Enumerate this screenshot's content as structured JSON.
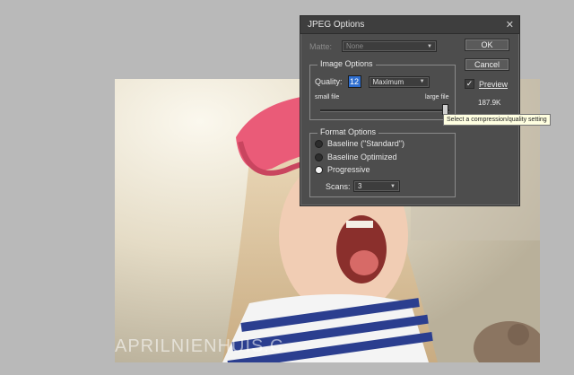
{
  "dialog": {
    "title": "JPEG Options",
    "close_icon": "close-icon",
    "matte_label": "Matte:",
    "matte_value": "None",
    "ok_label": "OK",
    "cancel_label": "Cancel",
    "preview_label": "Preview",
    "preview_checked": true,
    "file_size": "187.9K",
    "image_options": {
      "title": "Image Options",
      "quality_label": "Quality:",
      "quality_value": "12",
      "quality_preset": "Maximum",
      "small_file_label": "small file",
      "large_file_label": "large file",
      "slider_level": 1.0
    },
    "format_options": {
      "title": "Format Options",
      "options": [
        "Baseline (\"Standard\")",
        "Baseline Optimized",
        "Progressive"
      ],
      "selected": "Progressive",
      "scans_label": "Scans:",
      "scans_value": "3"
    }
  },
  "tooltip": "Select a compression/quality setting",
  "canvas": {
    "watermark": "APRILNIENHUIS.C"
  },
  "colors": {
    "workspace": "#b9b9b9",
    "dialog_bg": "#4d4d4d",
    "accent": "#2f6fd0"
  }
}
